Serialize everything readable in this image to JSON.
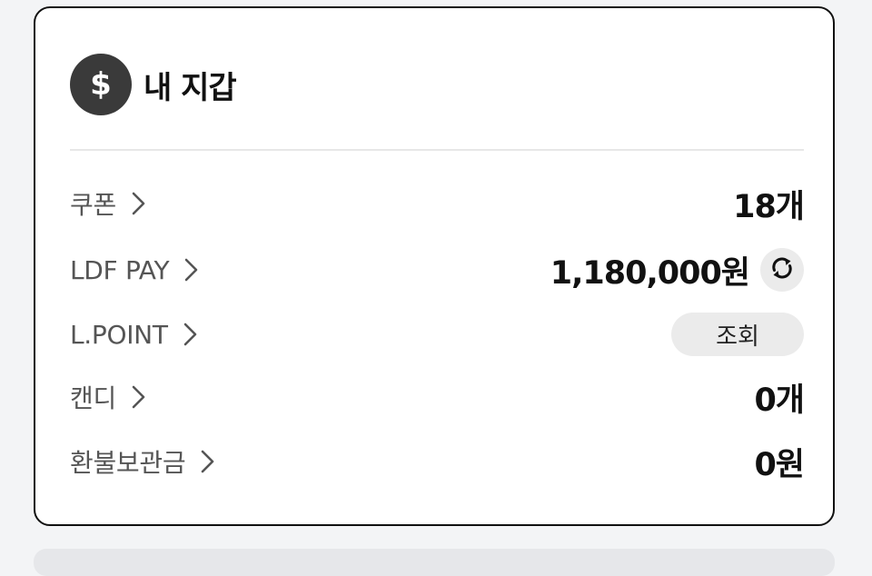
{
  "wallet": {
    "title": "내 지갑",
    "icon": "dollar-icon",
    "icon_glyph": "$",
    "rows": [
      {
        "key": "coupon",
        "label": "쿠폰",
        "value": "18개"
      },
      {
        "key": "ldf-pay",
        "label": "LDF PAY",
        "value": "1,180,000원",
        "action": "refresh-icon"
      },
      {
        "key": "lpoint",
        "label": "L.POINT",
        "button_label": "조회"
      },
      {
        "key": "candy",
        "label": "캔디",
        "value": "0개"
      },
      {
        "key": "refund",
        "label": "환불보관금",
        "value": "0원"
      }
    ]
  },
  "colors": {
    "accent_dark": "#3a3a3a",
    "label_gray": "#555555",
    "button_bg": "#ebebeb",
    "page_bg": "#f3f4f6"
  }
}
